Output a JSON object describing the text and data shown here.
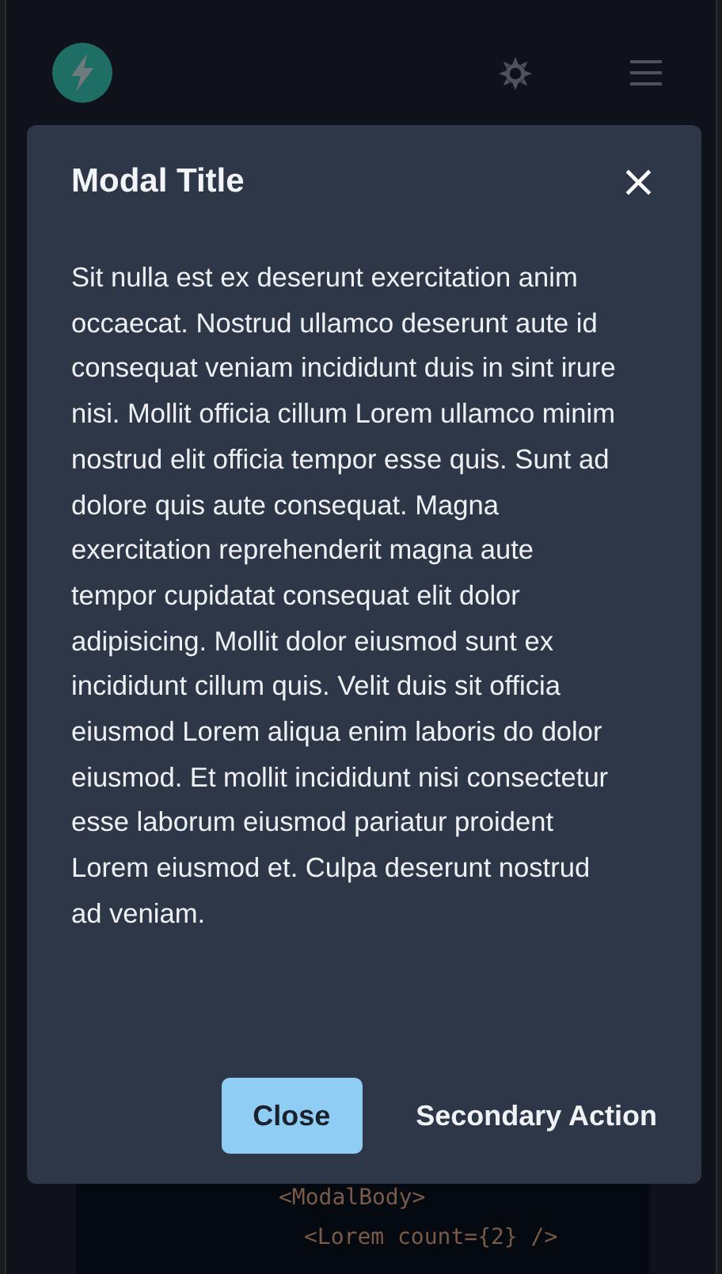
{
  "code": [
    {
      "text": "<ModalBody>",
      "indent": false
    },
    {
      "text": "<Lorem count={2} />",
      "indent": true
    }
  ],
  "modal": {
    "title": "Modal Title",
    "close": "×",
    "body": "Sit nulla est ex deserunt exercitation anim occaecat. Nostrud ullamco deserunt aute id consequat veniam incididunt duis in sint irure nisi. Mollit officia cillum Lorem ullamco minim nostrud elit officia tempor esse quis. Sunt ad dolore quis aute consequat. Magna exercitation reprehenderit magna aute tempor cupidatat consequat elit dolor adipisicing. Mollit dolor eiusmod sunt ex incididunt cillum quis. Velit duis sit officia eiusmod Lorem aliqua enim laboris do dolor eiusmod. Et mollit incididunt nisi consectetur esse laborum eiusmod pariatur proident Lorem eiusmod et. Culpa deserunt nostrud ad veniam.",
    "buttons": [
      {
        "label": "Close",
        "kind": "primary"
      },
      {
        "label": "Secondary Action",
        "kind": "ghost"
      }
    ]
  }
}
